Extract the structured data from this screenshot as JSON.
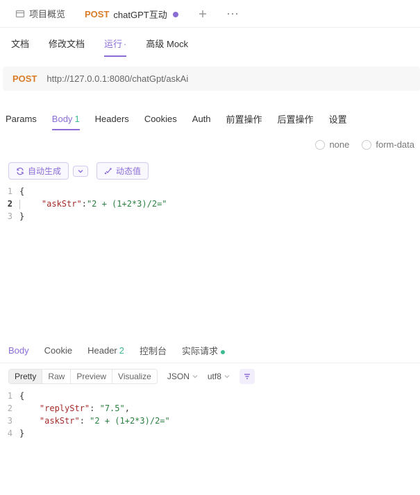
{
  "topTabs": {
    "overview": "项目概览",
    "activeMethod": "POST",
    "activeLabel": "chatGPT互动"
  },
  "subTabs": {
    "doc": "文档",
    "editDoc": "修改文档",
    "run": "运行",
    "mock": "高级 Mock"
  },
  "request": {
    "method": "POST",
    "url": "http://127.0.0.1:8080/chatGpt/askAi"
  },
  "reqTabs": {
    "params": "Params",
    "body": "Body",
    "bodyCount": "1",
    "headers": "Headers",
    "cookies": "Cookies",
    "auth": "Auth",
    "pre": "前置操作",
    "post": "后置操作",
    "settings": "设置"
  },
  "bodyTypes": {
    "none": "none",
    "formData": "form-data"
  },
  "editorToolbar": {
    "autoGen": "自动生成",
    "dynamic": "动态值"
  },
  "requestBody": {
    "line1": "{",
    "line2_key": "\"askStr\"",
    "line2_val": "\"2 + (1+2*3)/2=\"",
    "line3": "}"
  },
  "respTabs": {
    "body": "Body",
    "cookie": "Cookie",
    "header": "Header",
    "headerCount": "2",
    "console": "控制台",
    "realReq": "实际请求"
  },
  "respToolbar": {
    "pretty": "Pretty",
    "raw": "Raw",
    "preview": "Preview",
    "visualize": "Visualize",
    "format": "JSON",
    "encoding": "utf8"
  },
  "responseBody": {
    "line1": "{",
    "line2_key": "\"replyStr\"",
    "line2_val": "\"7.5\"",
    "line3_key": "\"askStr\"",
    "line3_val": "\"2 + (1+2*3)/2=\"",
    "line4": "}"
  }
}
